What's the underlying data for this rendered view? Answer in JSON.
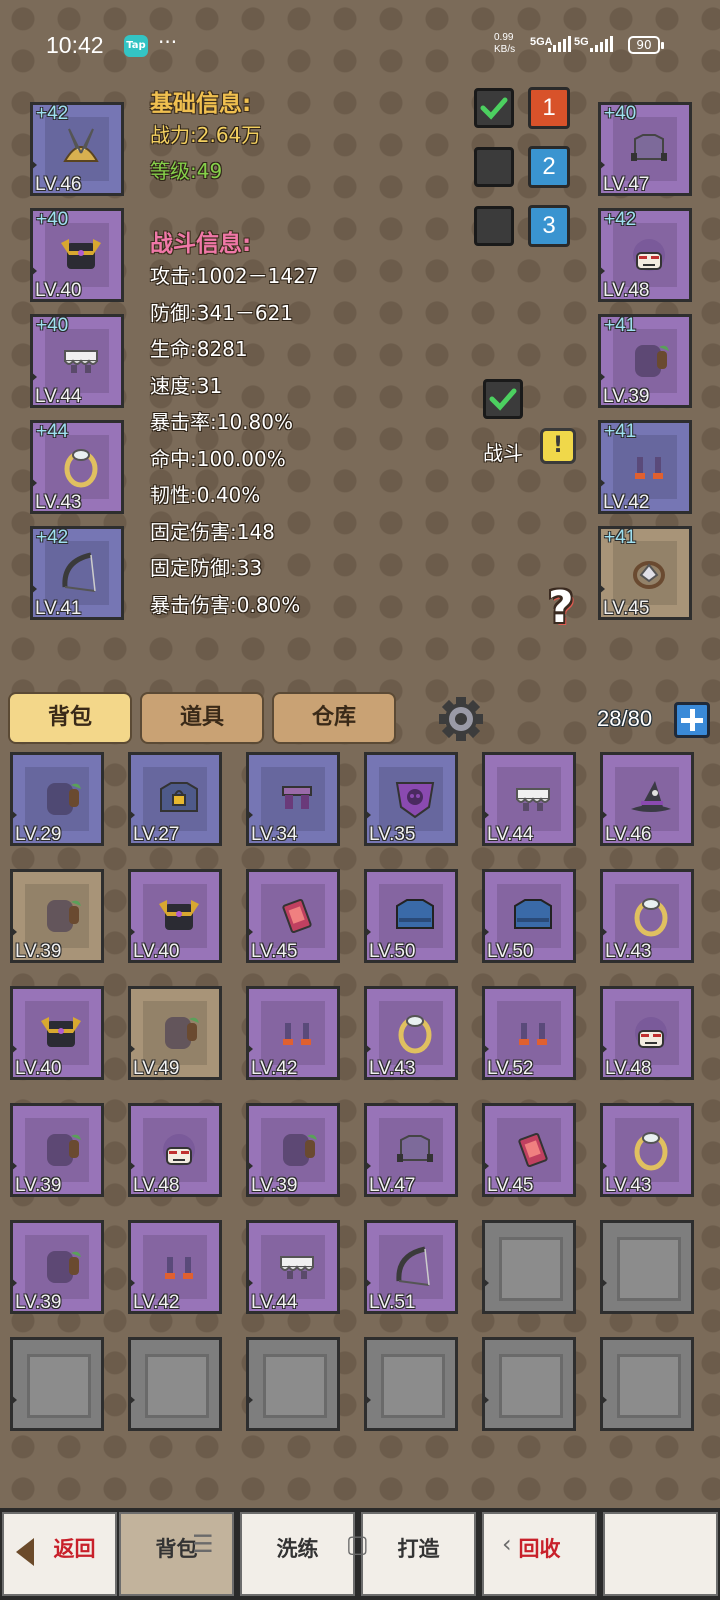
{
  "status_bar": {
    "time": "10:42",
    "app_badge": "Tap",
    "more": "···",
    "net_speed_value": "0.99",
    "net_speed_unit": "KB/s",
    "sig1_label": "5GA",
    "sig2_label": "5G",
    "battery": "90"
  },
  "basic_info": {
    "heading": "基础信息:",
    "power": "战力:2.64万",
    "level": "等级:49"
  },
  "battle_info": {
    "heading": "战斗信息:",
    "stats": [
      "攻击:1002－1427",
      "防御:341－621",
      "生命:8281",
      "速度:31",
      "暴击率:10.80%",
      "命中:100.00%",
      "韧性:0.40%",
      "固定伤害:148",
      "固定防御:33",
      "暴击伤害:0.80%"
    ]
  },
  "presets": [
    {
      "label": "1",
      "checked": true,
      "color": "#d8522a"
    },
    {
      "label": "2",
      "checked": false,
      "color": "#3a94d0"
    },
    {
      "label": "3",
      "checked": false,
      "color": "#3a94d0"
    }
  ],
  "battle_toggle": {
    "label": "战斗",
    "checked": true,
    "alert": "!"
  },
  "help": "?",
  "equipped_left": [
    {
      "plus": "+42",
      "lv": "LV.46",
      "quality": "blue",
      "icon": "winged-helmet-icon"
    },
    {
      "plus": "+40",
      "lv": "LV.40",
      "quality": "purple",
      "icon": "dark-armor-icon"
    },
    {
      "plus": "+40",
      "lv": "LV.44",
      "quality": "purple",
      "icon": "skirt-icon"
    },
    {
      "plus": "+44",
      "lv": "LV.43",
      "quality": "purple",
      "icon": "ring-icon"
    },
    {
      "plus": "+42",
      "lv": "LV.41",
      "quality": "blue",
      "icon": "bow-icon"
    }
  ],
  "equipped_right": [
    {
      "plus": "+40",
      "lv": "LV.47",
      "quality": "purple",
      "icon": "shirt-icon"
    },
    {
      "plus": "+42",
      "lv": "LV.48",
      "quality": "purple",
      "icon": "head-icon"
    },
    {
      "plus": "+41",
      "lv": "LV.39",
      "quality": "purple",
      "icon": "backpack-icon"
    },
    {
      "plus": "+41",
      "lv": "LV.42",
      "quality": "blue",
      "icon": "boots-icon"
    },
    {
      "plus": "+41",
      "lv": "LV.45",
      "quality": "tan",
      "icon": "gem-icon"
    }
  ],
  "tabs": [
    "背包",
    "道具",
    "仓库"
  ],
  "capacity": "28/80",
  "inventory": [
    {
      "lv": "LV.29",
      "quality": "blue",
      "icon": "backpack-icon"
    },
    {
      "lv": "LV.27",
      "quality": "blue",
      "icon": "locked-shirt-icon"
    },
    {
      "lv": "LV.34",
      "quality": "blue",
      "icon": "pants-icon"
    },
    {
      "lv": "LV.35",
      "quality": "blue",
      "icon": "skull-shield-icon"
    },
    {
      "lv": "LV.44",
      "quality": "purple",
      "icon": "skirt-icon"
    },
    {
      "lv": "LV.46",
      "quality": "purple",
      "icon": "witch-hat-icon"
    },
    {
      "lv": "LV.39",
      "quality": "tan",
      "icon": "backpack-icon"
    },
    {
      "lv": "LV.40",
      "quality": "purple",
      "icon": "dark-armor-icon"
    },
    {
      "lv": "LV.45",
      "quality": "purple",
      "icon": "card-icon"
    },
    {
      "lv": "LV.50",
      "quality": "purple",
      "icon": "jacket-icon"
    },
    {
      "lv": "LV.50",
      "quality": "purple",
      "icon": "jacket-icon"
    },
    {
      "lv": "LV.43",
      "quality": "purple",
      "icon": "ring-icon"
    },
    {
      "lv": "LV.40",
      "quality": "purple",
      "icon": "dark-armor-icon"
    },
    {
      "lv": "LV.49",
      "quality": "tan",
      "icon": "backpack-icon"
    },
    {
      "lv": "LV.42",
      "quality": "purple",
      "icon": "boots-icon"
    },
    {
      "lv": "LV.43",
      "quality": "purple",
      "icon": "ring-icon"
    },
    {
      "lv": "LV.52",
      "quality": "purple",
      "icon": "boots-icon"
    },
    {
      "lv": "LV.48",
      "quality": "purple",
      "icon": "head-icon"
    },
    {
      "lv": "LV.39",
      "quality": "purple",
      "icon": "backpack-icon"
    },
    {
      "lv": "LV.48",
      "quality": "purple",
      "icon": "head-icon"
    },
    {
      "lv": "LV.39",
      "quality": "purple",
      "icon": "backpack-icon"
    },
    {
      "lv": "LV.47",
      "quality": "purple",
      "icon": "shirt-icon"
    },
    {
      "lv": "LV.45",
      "quality": "purple",
      "icon": "card-icon"
    },
    {
      "lv": "LV.43",
      "quality": "purple",
      "icon": "ring-icon"
    },
    {
      "lv": "LV.39",
      "quality": "purple",
      "icon": "backpack-icon"
    },
    {
      "lv": "LV.42",
      "quality": "purple",
      "icon": "boots-icon"
    },
    {
      "lv": "LV.44",
      "quality": "purple",
      "icon": "skirt-icon"
    },
    {
      "lv": "LV.51",
      "quality": "purple",
      "icon": "bow-icon"
    }
  ],
  "empty_slots": 8,
  "bottom_buttons": [
    "返回",
    "背包",
    "洗练",
    "打造",
    "回收",
    ""
  ],
  "colors": {
    "purple": "#9874b8",
    "blue": "#7676b4",
    "tan": "#a89478",
    "empty": "#7e7e7e"
  }
}
